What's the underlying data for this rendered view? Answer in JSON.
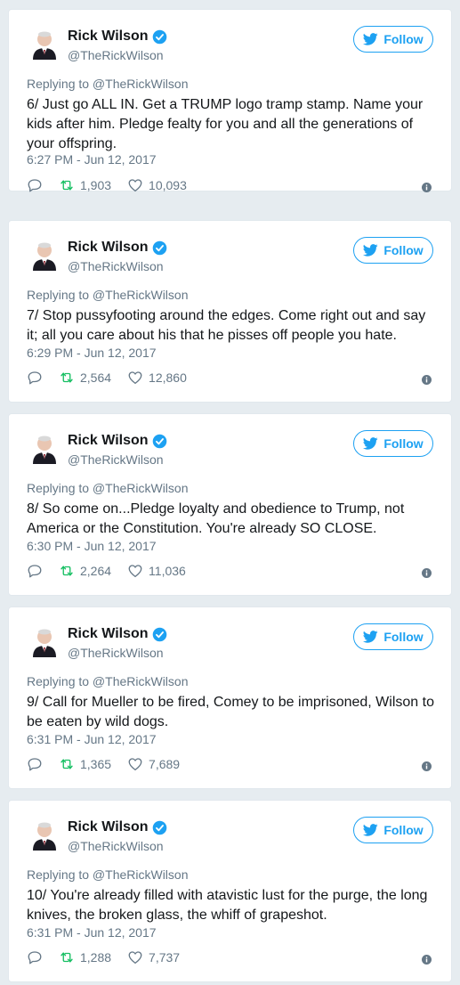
{
  "colors": {
    "accent": "#1da1f2",
    "muted": "#657786",
    "background": "#e6ecf0"
  },
  "icons": [
    "avatar",
    "verified-badge-icon",
    "twitter-bird-icon",
    "reply-icon",
    "retweet-icon",
    "like-icon",
    "info-icon"
  ],
  "tweets": [
    {
      "name": "Rick Wilson",
      "handle": "@TheRickWilson",
      "follow_label": "Follow",
      "replying_to": "Replying to @TheRickWilson",
      "text": "6/ Just go ALL IN. Get a TRUMP logo tramp stamp. Name your kids after him. Pledge fealty for you and all the generations of your offspring.",
      "timestamp": "6:27 PM - Jun 12, 2017",
      "retweets": "1,903",
      "likes": "10,093"
    },
    {
      "name": "Rick Wilson",
      "handle": "@TheRickWilson",
      "follow_label": "Follow",
      "replying_to": "Replying to @TheRickWilson",
      "text": "7/ Stop pussyfooting around the edges. Come right out and say it; all you care about his that he pisses off people you hate.",
      "timestamp": "6:29 PM - Jun 12, 2017",
      "retweets": "2,564",
      "likes": "12,860"
    },
    {
      "name": "Rick Wilson",
      "handle": "@TheRickWilson",
      "follow_label": "Follow",
      "replying_to": "Replying to @TheRickWilson",
      "text": "8/ So come on...Pledge loyalty and obedience to Trump, not America or the Constitution. You're already SO CLOSE.",
      "timestamp": "6:30 PM - Jun 12, 2017",
      "retweets": "2,264",
      "likes": "11,036"
    },
    {
      "name": "Rick Wilson",
      "handle": "@TheRickWilson",
      "follow_label": "Follow",
      "replying_to": "Replying to @TheRickWilson",
      "text": "9/ Call for Mueller to be fired, Comey to be imprisoned, Wilson to be eaten by wild dogs.",
      "timestamp": "6:31 PM - Jun 12, 2017",
      "retweets": "1,365",
      "likes": "7,689"
    },
    {
      "name": "Rick Wilson",
      "handle": "@TheRickWilson",
      "follow_label": "Follow",
      "replying_to": "Replying to @TheRickWilson",
      "text": "10/ You're already filled with atavistic lust for the purge, the long knives, the broken glass, the whiff of grapeshot.",
      "timestamp": "6:31 PM - Jun 12, 2017",
      "retweets": "1,288",
      "likes": "7,737"
    }
  ]
}
